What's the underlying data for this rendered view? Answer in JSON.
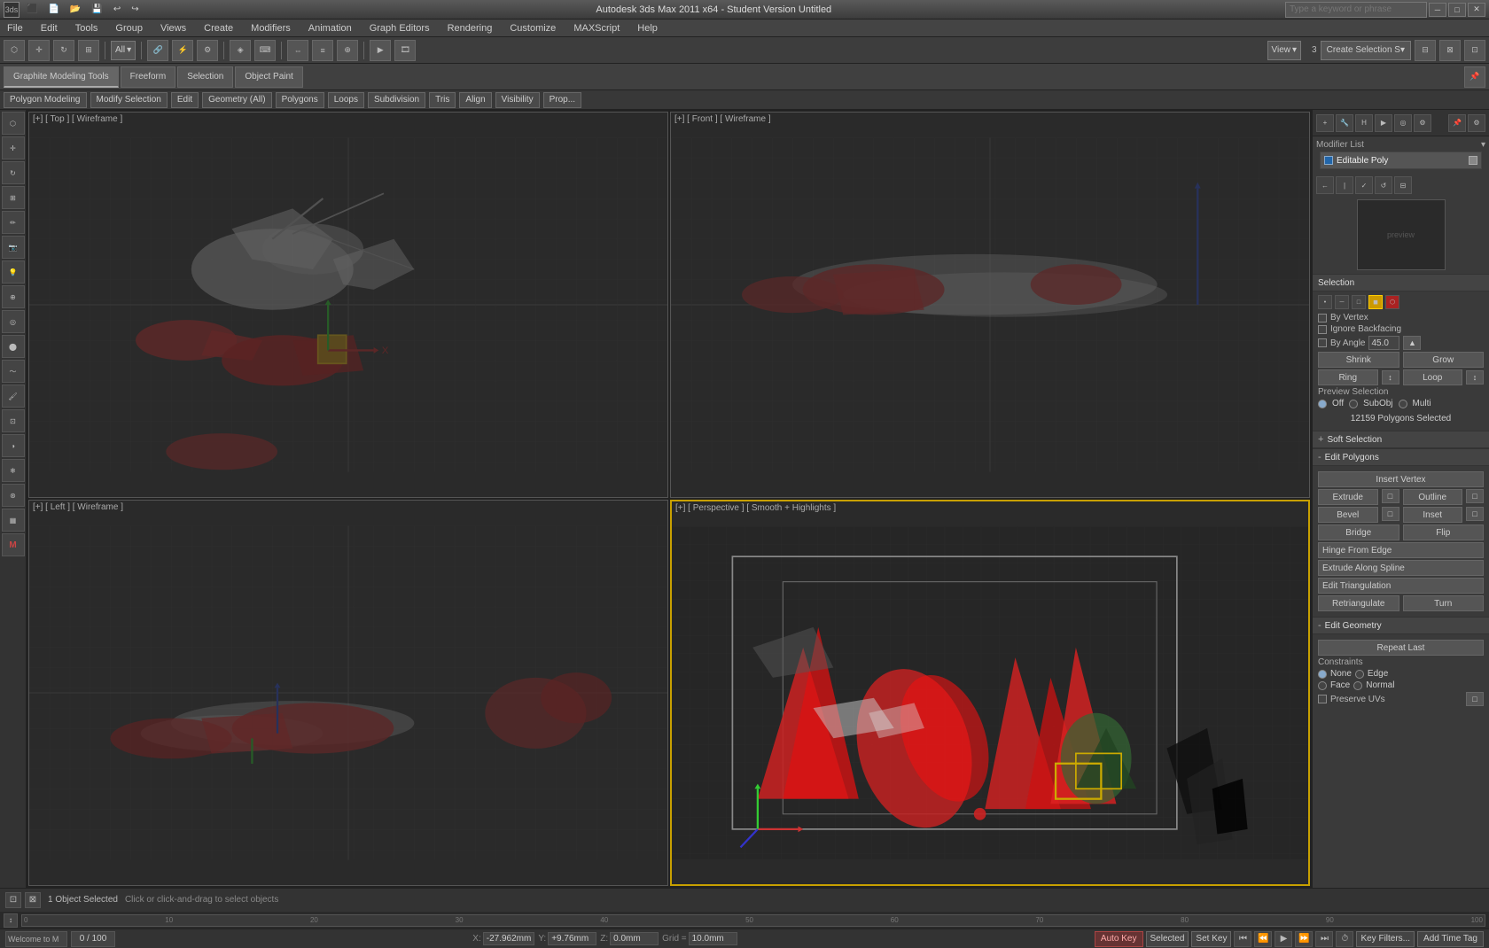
{
  "titleBar": {
    "title": "Autodesk 3ds Max 2011 x64 - Student Version   Untitled",
    "appLabel": "3ds",
    "searchPlaceholder": "Type a keyword or phrase",
    "winBtns": [
      "─",
      "□",
      "✕"
    ]
  },
  "menuBar": {
    "items": [
      "File",
      "Edit",
      "Tools",
      "Group",
      "Views",
      "Create",
      "Modifiers",
      "Animation",
      "Graph Editors",
      "Rendering",
      "Customize",
      "MAXScript",
      "Help"
    ]
  },
  "toolbar": {
    "createSelectionLabel": "Create Selection S▾",
    "viewLabel": "View",
    "allLabel": "All"
  },
  "ribbonTabs": {
    "tabs": [
      "Graphite Modeling Tools",
      "Freeform",
      "Selection",
      "Object Paint"
    ],
    "activeTab": "Graphite Modeling Tools"
  },
  "subRibbon": {
    "items": [
      "Polygon Modeling",
      "Modify Selection",
      "Edit",
      "Geometry (All)",
      "Polygons",
      "Loops",
      "Subdivision",
      "Tris",
      "Align",
      "Visibility",
      "Prop..."
    ]
  },
  "viewports": [
    {
      "id": "top-left",
      "label": "[+] [ Top ] [ Wireframe ]",
      "active": false
    },
    {
      "id": "top-right",
      "label": "[+] [ Front ] [ Wireframe ]",
      "active": false
    },
    {
      "id": "bottom-left",
      "label": "[+] [ Left ] [ Wireframe ]",
      "active": false
    },
    {
      "id": "bottom-right",
      "label": "[+] [ Perspective ] [ Smooth + Highlights ]",
      "active": true
    }
  ],
  "rightPanel": {
    "modifierLabel": "Modifier List",
    "modifierEntry": "Editable Poly",
    "selectionSection": "Selection",
    "byVertex": "By Vertex",
    "ignoreBackfacing": "Ignore Backfacing",
    "byAngle": "By Angle",
    "byAngleValue": "45.0",
    "shrink": "Shrink",
    "grow": "Grow",
    "ring": "Ring",
    "loop": "Loop",
    "previewSelection": "Preview Selection",
    "previewOff": "Off",
    "previewSubObj": "SubObj",
    "previewMulti": "Multi",
    "selectedInfo": "12159 Polygons Selected",
    "softSelectionPlus": "+",
    "softSelectionLabel": "Soft Selection",
    "editPolygonsMinus": "-",
    "editPolygonsLabel": "Edit Polygons",
    "insertVertex": "Insert Vertex",
    "extrude": "Extrude",
    "outline": "Outline",
    "bevel": "Bevel",
    "inset": "Inset",
    "bridge": "Bridge",
    "flip": "Flip",
    "hingeFromEdge": "Hinge From Edge",
    "extrudeAlongSpline": "Extrude Along Spline",
    "editTriangulation": "Edit Triangulation",
    "retriangulate": "Retriangulate",
    "turn": "Turn",
    "editGeometryMinus": "-",
    "editGeometryLabel": "Edit Geometry",
    "repeatLast": "Repeat Last",
    "constraintsLabel": "Constraints",
    "constraintNone": "None",
    "constraintEdge": "Edge",
    "constraintFace": "Face",
    "constraintNormal": "Normal",
    "preserveUVs": "Preserve UVs"
  },
  "statusBar": {
    "objectCount": "1 Object Selected",
    "hint": "Click or click-and-drag to select objects"
  },
  "bottomBar": {
    "xLabel": "X:",
    "xValue": "-27.962mm",
    "yLabel": "Y:",
    "yValue": "+9.76mm",
    "zLabel": "Z:",
    "zValue": "0.0mm",
    "gridLabel": "Grid =",
    "gridValue": "10.0mm",
    "autoKey": "Auto Key",
    "selected": "Selected",
    "setKey": "Set Key",
    "keyFilters": "Key Filters...",
    "addTimeTag": "Add Time Tag",
    "welcome": "Welcome to M",
    "timePosition": "0 / 100"
  },
  "colors": {
    "accent": "#c8a000",
    "background": "#3a3a3a",
    "viewportBg": "#2a2a2a",
    "panelBg": "#3a3a3a",
    "activeBorder": "#c8a000",
    "gridLine": "#444444",
    "modelRed": "#cc2222",
    "modelWhite": "#dddddd"
  }
}
